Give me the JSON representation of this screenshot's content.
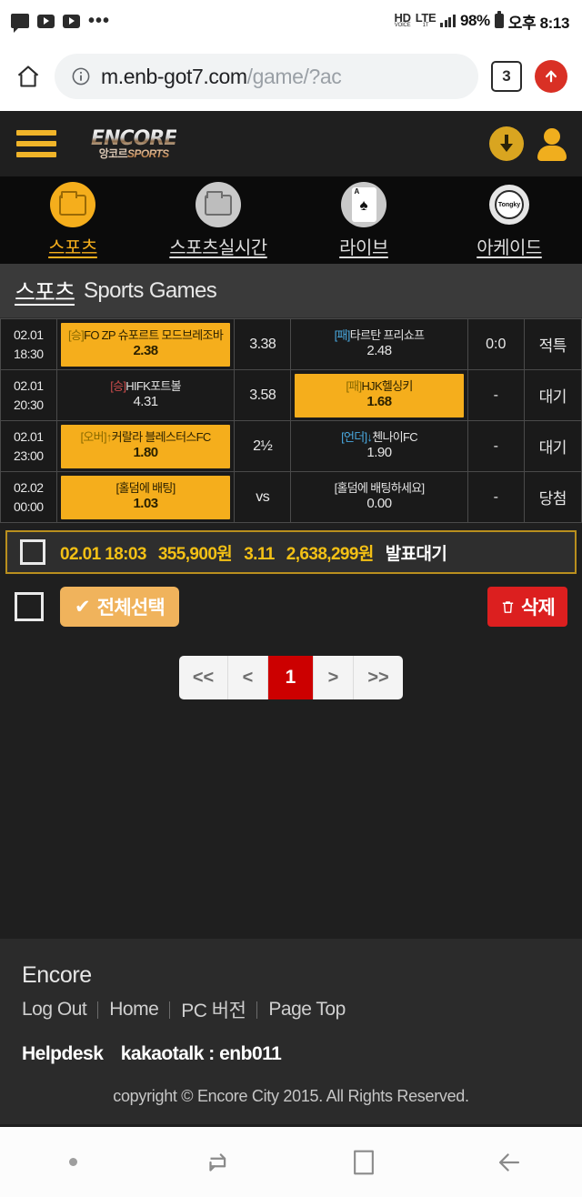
{
  "status_bar": {
    "icons": [
      "chat-icon",
      "youtube-icon",
      "youtube-icon",
      "overflow-dots-icon"
    ],
    "hd_label": "HD",
    "hd_sub": "VOICE",
    "lte_label": "LTE",
    "lte_sub": "1T",
    "battery_percent": "98%",
    "clock": "오후 8:13"
  },
  "browser": {
    "url_prefix": "m.enb-got7.com",
    "url_suffix": "/game/?ac",
    "tab_count": "3"
  },
  "site_header": {
    "logo_line1": "ENCORE",
    "logo_ko": "앙코르",
    "logo_en": "SPORTS"
  },
  "nav_tabs": [
    {
      "label": "스포츠",
      "icon": "folder-open-icon",
      "active": true
    },
    {
      "label": "스포츠실시간",
      "icon": "folder-icon",
      "active": false
    },
    {
      "label": "라이브",
      "icon": "spade-card-icon",
      "active": false
    },
    {
      "label": "아케이드",
      "icon": "soccer-ball-icon",
      "active": false,
      "ball_text": "Tongky"
    }
  ],
  "page_title": {
    "ko": "스포츠",
    "en": "Sports Games"
  },
  "bet_rows": [
    {
      "date": "02.01",
      "time": "18:30",
      "home": {
        "tag": "[승]",
        "tag_color": "gold",
        "name": "FO ZP 슈포르트 모드브레조바",
        "value": "2.38",
        "selected": true
      },
      "odds": "3.38",
      "away": {
        "tag": "[패]",
        "tag_color": "blue",
        "name": "타르탄 프리쇼프",
        "value": "2.48",
        "selected": false
      },
      "score": "0:0",
      "status": "적특",
      "status_color": "blue"
    },
    {
      "date": "02.01",
      "time": "20:30",
      "home": {
        "tag": "[승]",
        "tag_color": "red",
        "name": "HIFK포트볼",
        "value": "4.31",
        "selected": false
      },
      "odds": "3.58",
      "away": {
        "tag": "[패]",
        "tag_color": "gold",
        "name": "HJK헬싱키",
        "value": "1.68",
        "selected": true
      },
      "score": "-",
      "status": "대기",
      "status_color": "plain"
    },
    {
      "date": "02.01",
      "time": "23:00",
      "home": {
        "tag": "[오버]↑",
        "tag_color": "gold",
        "name": "커랄라 블레스터스FC",
        "value": "1.80",
        "selected": true
      },
      "odds": "2½",
      "away": {
        "tag": "[언더]↓",
        "tag_color": "blue",
        "name": "첸나이FC",
        "value": "1.90",
        "selected": false
      },
      "score": "-",
      "status": "대기",
      "status_color": "plain"
    },
    {
      "date": "02.02",
      "time": "00:00",
      "home": {
        "tag": "",
        "tag_color": "cyan",
        "name": "[홀덤에 배팅]",
        "value": "1.03",
        "selected": true
      },
      "odds": "vs",
      "away": {
        "tag": "",
        "tag_color": "cyan",
        "name": "[홀덤에 배팅하세요]",
        "value": "0.00",
        "selected": false
      },
      "score": "-",
      "status": "당첨",
      "status_color": "blue"
    }
  ],
  "summary": {
    "date": "02.01 18:03",
    "stake": "355,900원",
    "odds": "3.11",
    "payout": "2,638,299원",
    "state": "발표대기"
  },
  "actions": {
    "select_all_label": "전체선택",
    "select_all_check": "✔",
    "delete_label": "삭제",
    "delete_icon": "trash-icon"
  },
  "pagination": {
    "first": "<<",
    "prev": "<",
    "current": "1",
    "next": ">",
    "last": ">>"
  },
  "footer": {
    "brand": "Encore",
    "links": [
      "Log Out",
      "Home",
      "PC 버전",
      "Page Top"
    ],
    "helpdesk_label": "Helpdesk",
    "helpdesk_value": "kakaotalk : enb011",
    "copyright": "copyright © Encore City 2015. All Rights Reserved."
  },
  "android_nav": {
    "items": [
      "dot-indicator",
      "recents-icon",
      "home-icon",
      "back-icon"
    ]
  },
  "colors": {
    "accent_gold": "#f5ae1c",
    "danger_red": "#dc1f1f",
    "page_red": "#cc0000",
    "status_blue": "#49b2e8",
    "dark_bg": "#1f1f1f"
  }
}
